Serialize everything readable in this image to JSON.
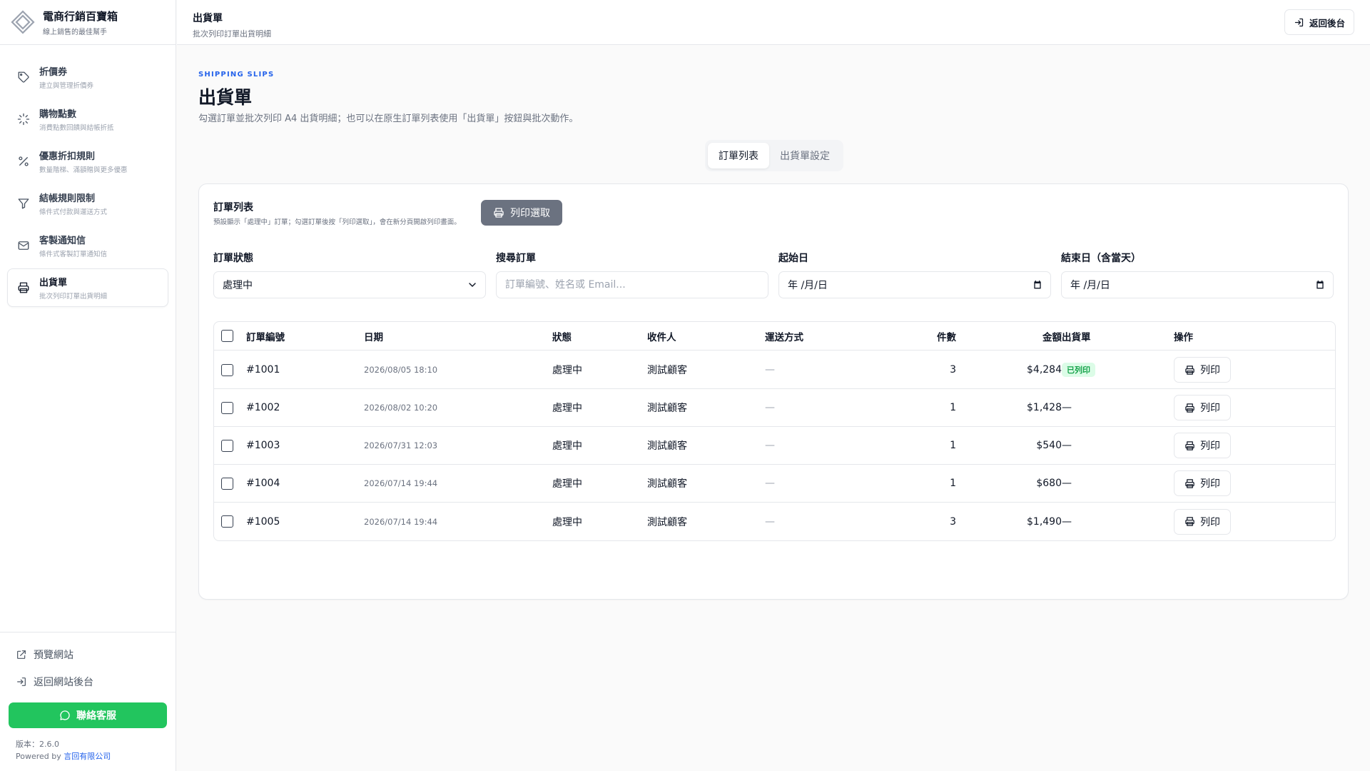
{
  "brand": {
    "title": "電商行銷百寶箱",
    "subtitle": "線上銷售的最佳幫手"
  },
  "sidebar": {
    "items": [
      {
        "label": "折價券",
        "sub": "建立與管理折價券",
        "icon": "tag-icon"
      },
      {
        "label": "購物點數",
        "sub": "消費點數回饋與結帳折抵",
        "icon": "sparkle-icon"
      },
      {
        "label": "優惠折扣規則",
        "sub": "數量階梯、滿額贈與更多優惠",
        "icon": "percent-icon"
      },
      {
        "label": "結帳規則限制",
        "sub": "條件式付款與運送方式",
        "icon": "filter-icon"
      },
      {
        "label": "客製通知信",
        "sub": "條件式客製訂單通知信",
        "icon": "mail-icon"
      },
      {
        "label": "出貨單",
        "sub": "批次列印訂單出貨明細",
        "icon": "printer-icon",
        "active": true
      }
    ],
    "preview_label": "預覽網站",
    "back_admin_label": "返回網站後台",
    "contact_label": "聯絡客服",
    "version_text": "版本：2.6.0",
    "powered_prefix": "Powered by",
    "powered_company": "言回有限公司"
  },
  "topbar": {
    "title": "出貨單",
    "subtitle": "批次列印訂單出貨明細",
    "back_label": "返回後台"
  },
  "page": {
    "eyebrow": "SHIPPING SLIPS",
    "title": "出貨單",
    "description": "勾選訂單並批次列印 A4 出貨明細；也可以在原生訂單列表使用「出貨單」按鈕與批次動作。"
  },
  "tabs": [
    {
      "label": "訂單列表",
      "active": true
    },
    {
      "label": "出貨單設定",
      "active": false
    }
  ],
  "card": {
    "title": "訂單列表",
    "subtitle": "預設顯示「處理中」訂單；勾選訂單後按「列印選取」，會在新分頁開啟列印畫面。",
    "print_selected_label": "列印選取"
  },
  "filters": {
    "status": {
      "label": "訂單狀態",
      "value": "處理中"
    },
    "search": {
      "label": "搜尋訂單",
      "placeholder": "訂單編號、姓名或 Email..."
    },
    "start": {
      "label": "起始日",
      "value": "年 /月/日"
    },
    "end": {
      "label": "結束日（含當天）",
      "value": "年 /月/日"
    }
  },
  "table": {
    "headers": {
      "order": "訂單編號",
      "date": "日期",
      "status": "狀態",
      "recipient": "收件人",
      "shipping": "運送方式",
      "qty": "件數",
      "amount": "金額",
      "slip": "出貨單",
      "action": "操作"
    },
    "print_label": "列印",
    "rows": [
      {
        "order": "#1001",
        "date": "2026/08/05 18:10",
        "status": "處理中",
        "recipient": "測試顧客",
        "shipping": "—",
        "qty": "3",
        "amount": "$4,284",
        "slip": "已列印"
      },
      {
        "order": "#1002",
        "date": "2026/08/02 10:20",
        "status": "處理中",
        "recipient": "測試顧客",
        "shipping": "—",
        "qty": "1",
        "amount": "$1,428",
        "slip": "—"
      },
      {
        "order": "#1003",
        "date": "2026/07/31 12:03",
        "status": "處理中",
        "recipient": "測試顧客",
        "shipping": "—",
        "qty": "1",
        "amount": "$540",
        "slip": "—"
      },
      {
        "order": "#1004",
        "date": "2026/07/14 19:44",
        "status": "處理中",
        "recipient": "測試顧客",
        "shipping": "—",
        "qty": "1",
        "amount": "$680",
        "slip": "—"
      },
      {
        "order": "#1005",
        "date": "2026/07/14 19:44",
        "status": "處理中",
        "recipient": "測試顧客",
        "shipping": "—",
        "qty": "3",
        "amount": "$1,490",
        "slip": "—"
      }
    ]
  },
  "colors": {
    "accent": "#2563eb",
    "contact": "#22c55e",
    "printed_badge": "#16a34a",
    "print_selected_bg": "#6b7280"
  }
}
